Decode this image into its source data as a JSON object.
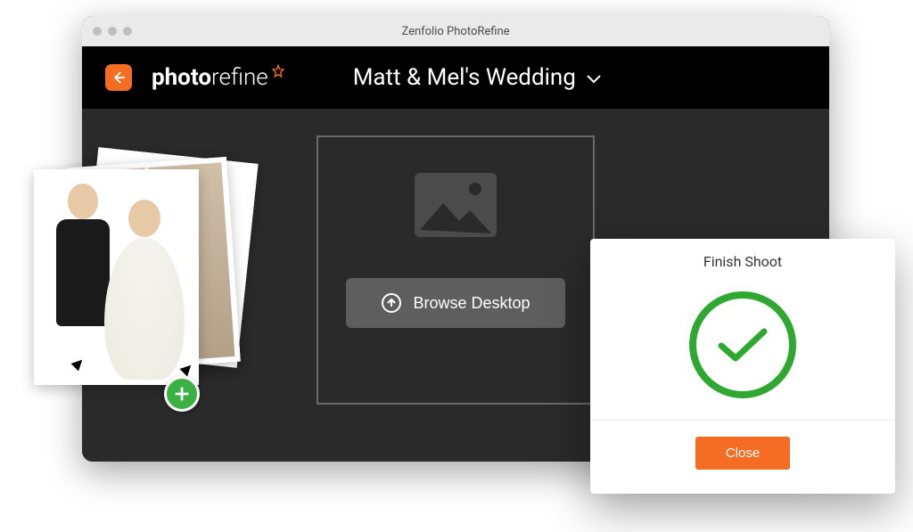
{
  "window": {
    "title": "Zenfolio PhotoRefine"
  },
  "header": {
    "logo_prefix": "photo",
    "logo_suffix": "refine",
    "album_name": "Matt & Mel's Wedding"
  },
  "dropzone": {
    "browse_label": "Browse Desktop"
  },
  "dialog": {
    "title": "Finish Shoot",
    "close_label": "Close"
  },
  "icons": {
    "back": "back-arrow",
    "chevron": "chevron-down",
    "image_placeholder": "image",
    "upload": "cloud-upload",
    "star": "star-outline",
    "success": "checkmark",
    "add": "plus"
  },
  "colors": {
    "accent": "#f46d22",
    "success": "#2ea830",
    "add": "#3bb143",
    "panel": "#2a2a2a"
  }
}
